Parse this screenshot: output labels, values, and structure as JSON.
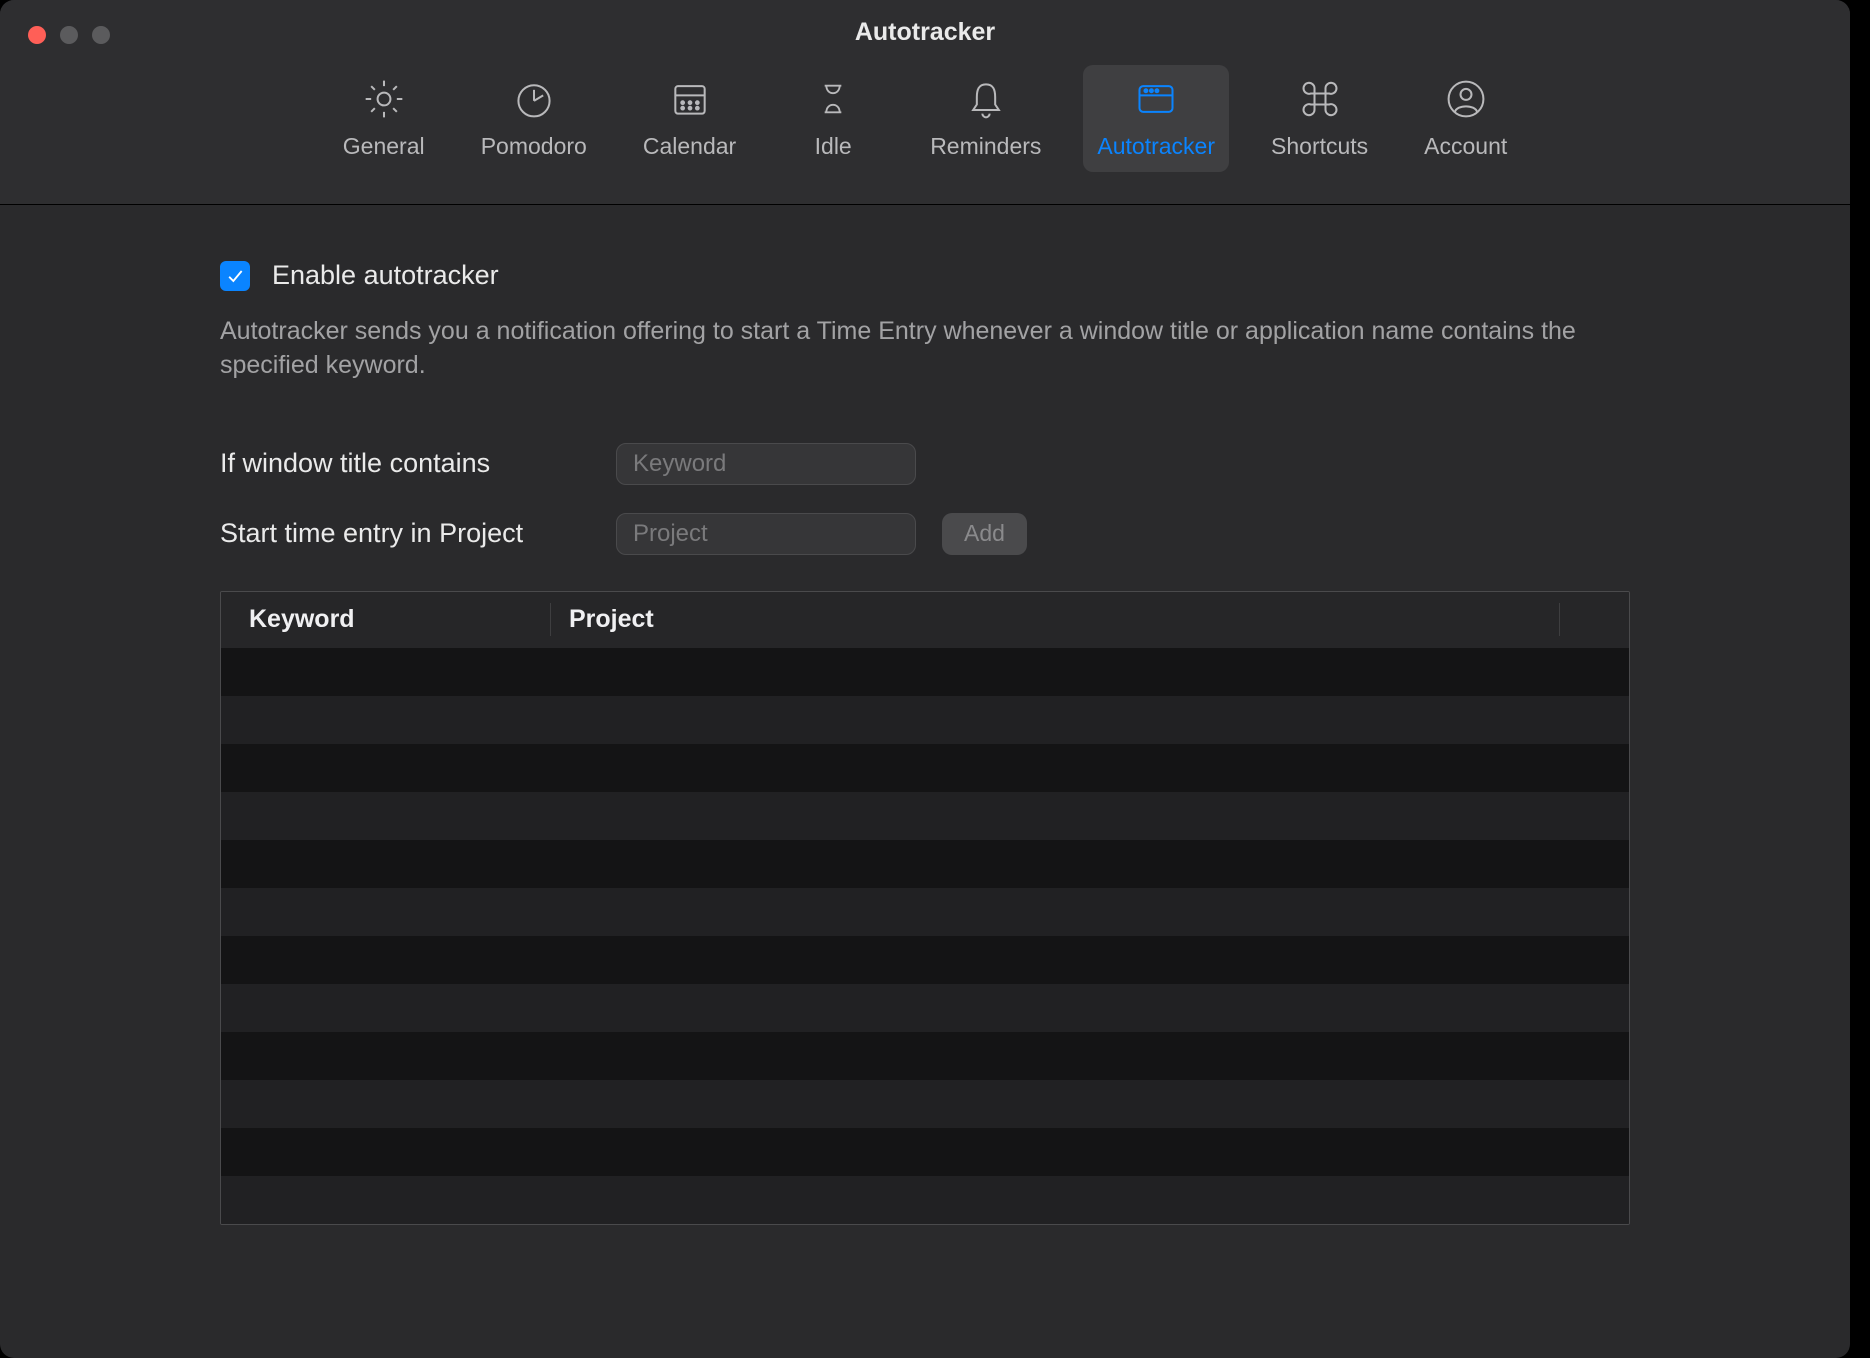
{
  "window": {
    "title": "Autotracker"
  },
  "toolbar": {
    "tabs": [
      {
        "label": "General",
        "icon": "gear-icon",
        "selected": false
      },
      {
        "label": "Pomodoro",
        "icon": "timer-icon",
        "selected": false
      },
      {
        "label": "Calendar",
        "icon": "calendar-icon",
        "selected": false
      },
      {
        "label": "Idle",
        "icon": "hourglass-icon",
        "selected": false
      },
      {
        "label": "Reminders",
        "icon": "bell-icon",
        "selected": false
      },
      {
        "label": "Autotracker",
        "icon": "window-icon",
        "selected": true
      },
      {
        "label": "Shortcuts",
        "icon": "command-icon",
        "selected": false
      },
      {
        "label": "Account",
        "icon": "user-icon",
        "selected": false
      }
    ]
  },
  "main": {
    "enable_checkbox_checked": true,
    "enable_label": "Enable autotracker",
    "description": "Autotracker sends you a notification offering to start a Time Entry whenever a window title or application name contains the specified keyword.",
    "keyword_label": "If window title contains",
    "keyword_placeholder": "Keyword",
    "project_label": "Start time entry in Project",
    "project_placeholder": "Project",
    "add_button_label": "Add",
    "table": {
      "columns": [
        "Keyword",
        "Project"
      ],
      "rows": []
    }
  }
}
